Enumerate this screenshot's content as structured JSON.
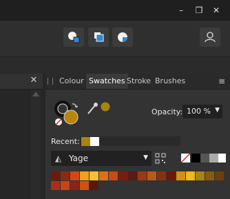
{
  "window": {
    "minimize_glyph": "–",
    "restore_glyph": "❐",
    "close_glyph": "✕"
  },
  "toolbar": {
    "icons": [
      "shapes-icon",
      "shapes-layered-icon",
      "pie-shape-icon"
    ],
    "user_icon": "user-icon"
  },
  "left_panel": {
    "close_glyph": "✕"
  },
  "panel": {
    "tabs": [
      "Colour",
      "Swatches",
      "Stroke",
      "Brushes"
    ],
    "active_tab": "Swatches",
    "menu_glyph": "≡"
  },
  "colour": {
    "fill_color": "#b8860b",
    "stroke_color": "#111111",
    "eyedropper_sample_color": "#a88412"
  },
  "opacity": {
    "label": "Opacity:",
    "value": "100 %"
  },
  "recent": {
    "label": "Recent:",
    "swatches": [
      "#a88412",
      "#ffffff"
    ]
  },
  "palette": {
    "name": "Yage"
  },
  "grayscale_swatches": [
    "#ffffff",
    "#000000",
    "#555555",
    "#aaaaaa",
    "#ffffff"
  ],
  "swatches": [
    "#6b1a10",
    "#8a2a10",
    "#d4471a",
    "#f0a21a",
    "#f4c030",
    "#e07018",
    "#c84a14",
    "#7a1c10",
    "#5a1a14",
    "#9a3a12",
    "#b85a18",
    "#8a3010",
    "#6a1808",
    "#d49012",
    "#f0b818",
    "#a88412",
    "#8a5a10",
    "#6a4010",
    "#a83018",
    "#c84418",
    "#8a2418",
    "#d05018",
    "#5a1808"
  ]
}
